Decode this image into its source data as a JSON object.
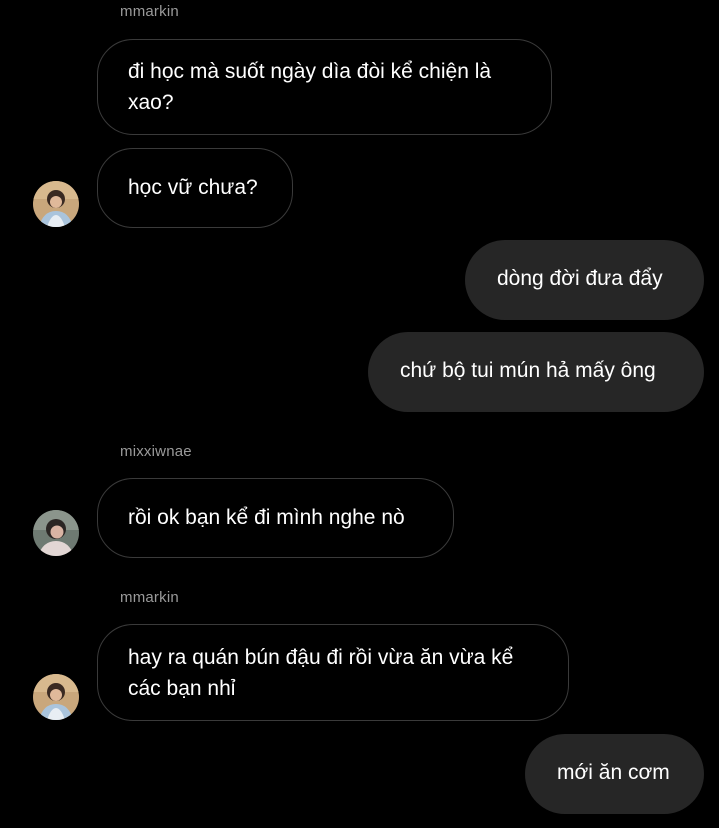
{
  "messages": [
    {
      "sender": "mmarkin",
      "text": "đi học mà suốt ngày dìa đòi kể chiện là xao?"
    },
    {
      "text": "học vữ chưa?",
      "avatar": "profile-photo-mmarkin"
    },
    {
      "text": "dòng đời đưa đẩy"
    },
    {
      "text": "chứ bộ tui mún hả mấy ông"
    },
    {
      "sender": "mixxiwnae",
      "text": "rồi ok bạn kể đi mình nghe nò",
      "avatar": "profile-photo-mixxiwnae"
    },
    {
      "sender": "mmarkin",
      "text": "hay ra quán bún đậu đi rồi vừa ăn vừa kể các bạn nhỉ",
      "avatar": "profile-photo-mmarkin"
    },
    {
      "text": "mới ăn cơm"
    }
  ],
  "colors": {
    "background": "#000000",
    "outgoing_bubble": "#262626",
    "incoming_border": "#3a3a3a",
    "sender_name": "#9a9a9a",
    "text": "#ffffff"
  }
}
